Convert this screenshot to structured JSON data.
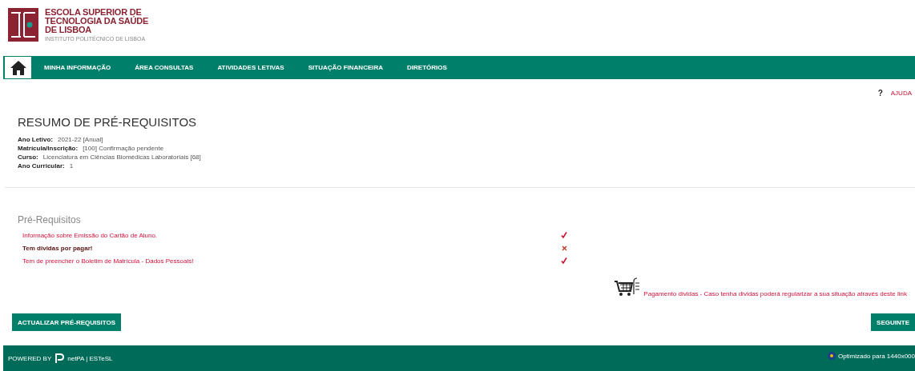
{
  "logo": {
    "name_lines": [
      "ESCOLA SUPERIOR DE",
      "TECNOLOGIA DA SAÚDE",
      "DE LISBOA"
    ],
    "subtitle": "INSTITUTO POLITÉCNICO DE LISBOA"
  },
  "nav": {
    "items": [
      "MINHA INFORMAÇÃO",
      "ÁREA CONSULTAS",
      "ATIVIDADES LETIVAS",
      "SITUAÇÃO FINANCEIRA",
      "DIRETÓRIOS"
    ]
  },
  "help": {
    "mark": "?",
    "label": "AJUDA"
  },
  "title": "RESUMO DE PRÉ-REQUISITOS",
  "info": [
    {
      "label": "Ano Letivo:",
      "value": "2021-22 [Anual]"
    },
    {
      "label": "Matrícula/Inscrição:",
      "value": "[100] Confirmação pendente"
    },
    {
      "label": "Curso:",
      "value": "Licenciatura em Ciências Biomédicas Laboratoriais [68]"
    },
    {
      "label": "Ano Curricular:",
      "value": "1"
    }
  ],
  "prerequisites": {
    "heading": "Pré-Requisitos",
    "items": [
      {
        "text": "Informação sobre Emissão do Cartão de Aluno.",
        "satisfied": true
      },
      {
        "text": "Tem dividas por pagar!",
        "satisfied": false
      },
      {
        "text": "Tem de preencher o Boletim de Matrícula - Dados Pessoais!",
        "satisfied": true
      }
    ]
  },
  "payment": {
    "link": "Pagamento dividas - Caso tenha dividas poderá regularizar a sua situação através deste link"
  },
  "buttons": {
    "refresh": "ACTUALIZAR PRÉ-REQUISITOS",
    "next": "SEGUINTE"
  },
  "footer": {
    "powered": "POWERED BY",
    "product": "netPA | ESTeSL",
    "optimized": "Optimizado para 1440x000"
  }
}
